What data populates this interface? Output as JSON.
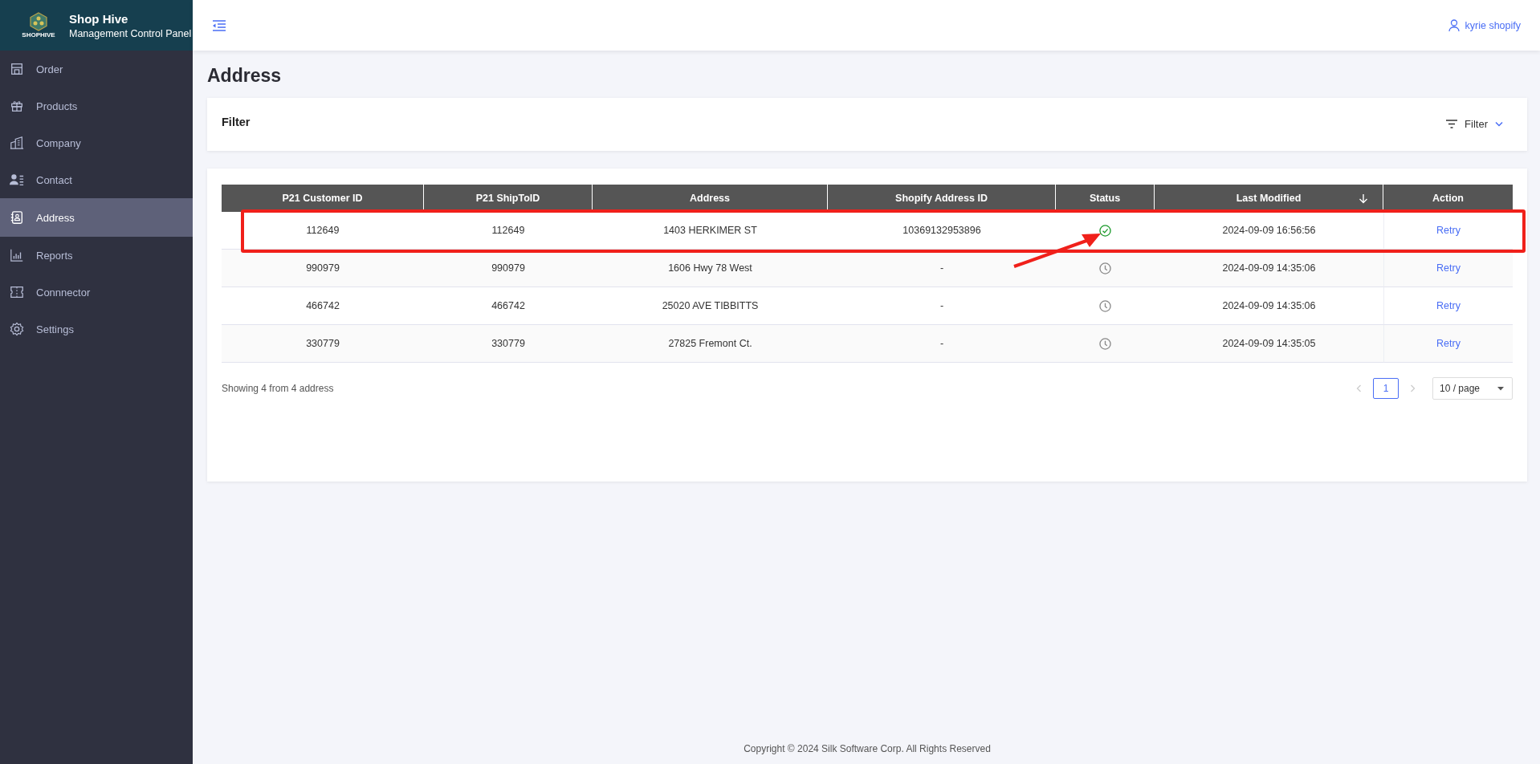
{
  "brand": {
    "name": "Shop Hive",
    "subtitle": "Management Control Panel",
    "logo_text": "SHOPHIVE"
  },
  "sidebar": {
    "items": [
      {
        "label": "Order",
        "selected": false
      },
      {
        "label": "Products",
        "selected": false
      },
      {
        "label": "Company",
        "selected": false
      },
      {
        "label": "Contact",
        "selected": false
      },
      {
        "label": "Address",
        "selected": true
      },
      {
        "label": "Reports",
        "selected": false
      },
      {
        "label": "Connnector",
        "selected": false
      },
      {
        "label": "Settings",
        "selected": false
      }
    ]
  },
  "header": {
    "user": "kyrie shopify"
  },
  "page_title": "Address",
  "filter_card": {
    "title": "Filter",
    "button": "Filter"
  },
  "table": {
    "columns": [
      {
        "label": "P21 Customer ID",
        "sortable": false
      },
      {
        "label": "P21 ShipToID",
        "sortable": false
      },
      {
        "label": "Address",
        "sortable": false
      },
      {
        "label": "Shopify Address ID",
        "sortable": false
      },
      {
        "label": "Status",
        "sortable": false
      },
      {
        "label": "Last Modified",
        "sortable": true
      },
      {
        "label": "Action",
        "sortable": false
      }
    ],
    "rows": [
      {
        "customer_id": "112649",
        "ship_to_id": "112649",
        "address": "1403 HERKIMER ST",
        "shopify_id": "10369132953896",
        "kind": "success",
        "last_modified": "2024-09-09 16:56:56",
        "action": "Retry",
        "highlighted": true
      },
      {
        "customer_id": "990979",
        "ship_to_id": "990979",
        "address": "1606 Hwy 78 West",
        "shopify_id": "-",
        "kind": "pending",
        "last_modified": "2024-09-09 14:35:06",
        "action": "Retry",
        "highlighted": false
      },
      {
        "customer_id": "466742",
        "ship_to_id": "466742",
        "address": "25020 AVE TIBBITTS",
        "shopify_id": "-",
        "kind": "pending",
        "last_modified": "2024-09-09 14:35:06",
        "action": "Retry",
        "highlighted": false
      },
      {
        "customer_id": "330779",
        "ship_to_id": "330779",
        "address": "27825 Fremont Ct.",
        "shopify_id": "-",
        "kind": "pending",
        "last_modified": "2024-09-09 14:35:05",
        "action": "Retry",
        "highlighted": false
      }
    ]
  },
  "summary": "Showing 4 from 4 address",
  "pagination": {
    "pages": [
      {
        "label": "1",
        "selected": true
      }
    ],
    "page_size": "10 / page"
  },
  "footer": "Copyright © 2024 Silk Software Corp. All Rights Reserved"
}
